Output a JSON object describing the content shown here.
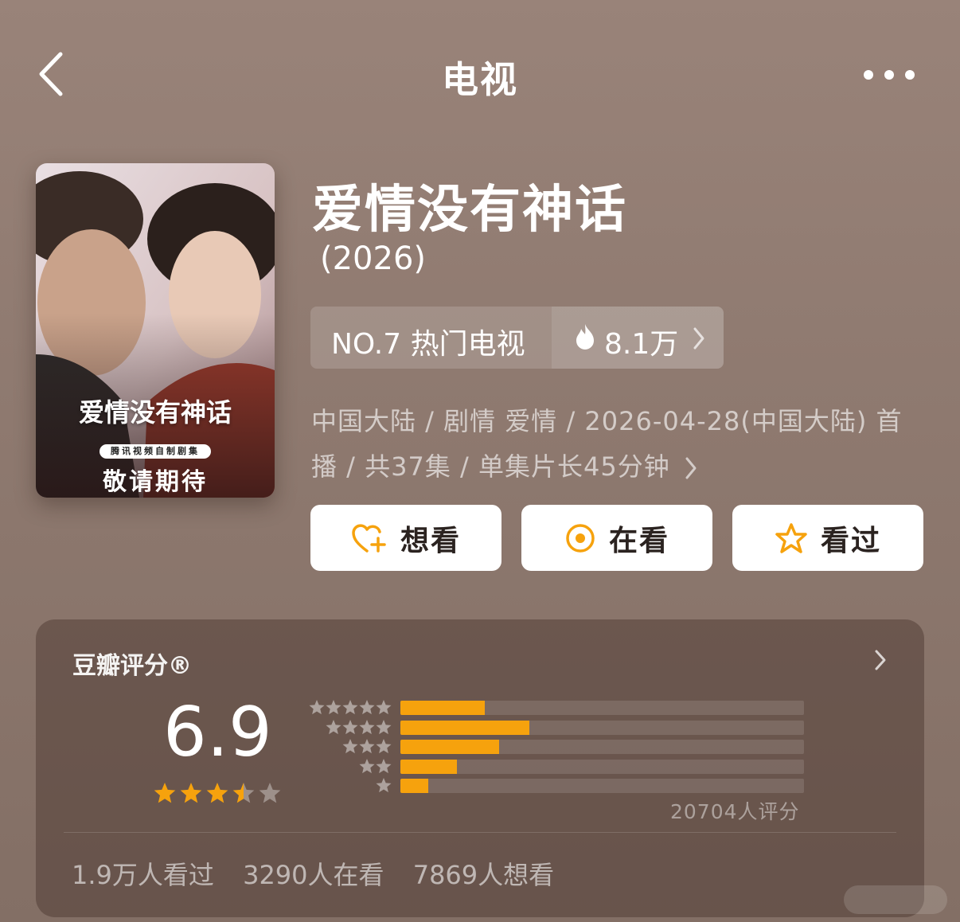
{
  "nav": {
    "title": "电视",
    "back_icon": "chevron-left-icon",
    "more_icon": "more-dots-icon"
  },
  "poster": {
    "title": "爱情没有神话",
    "badge": "腾讯视频自制剧集",
    "tagline": "敬请期待"
  },
  "show": {
    "title": "爱情没有神话",
    "year": "(2026)",
    "rank_label": "NO.7 热门电视",
    "heat": "8.1万",
    "meta_line1": "中国大陆 / 剧情 爱情 / 2026-04-28(中国大陆) 首",
    "meta_line2": "播 / 共37集 / 单集片长45分钟"
  },
  "actions": {
    "want": "想看",
    "watching": "在看",
    "watched": "看过"
  },
  "rating": {
    "title": "豆瓣评分®",
    "score": "6.9",
    "stars": 3.5,
    "distribution": [
      {
        "stars": 5,
        "fraction": 0.21
      },
      {
        "stars": 4,
        "fraction": 0.32
      },
      {
        "stars": 3,
        "fraction": 0.245
      },
      {
        "stars": 2,
        "fraction": 0.14
      },
      {
        "stars": 1,
        "fraction": 0.07
      }
    ],
    "count": "20704人评分",
    "stats": [
      "1.9万人看过",
      "3290人在看",
      "7869人想看"
    ]
  },
  "colors": {
    "accent": "#f6a20d",
    "background": "#917b71",
    "button_bg": "#ffffff"
  }
}
